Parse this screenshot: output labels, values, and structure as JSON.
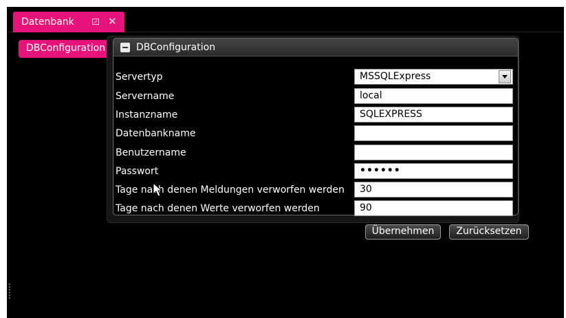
{
  "tab": {
    "title": "Datenbank",
    "close_glyph": "✕",
    "pin_icon": "pin-icon"
  },
  "subtab": {
    "label": "DBConfiguration"
  },
  "panel": {
    "title": "DBConfiguration",
    "collapse_icon": "collapse-minus-icon"
  },
  "form": {
    "rows": [
      {
        "label": "Servertyp",
        "value": "MSSQLExpress",
        "type": "dropdown"
      },
      {
        "label": "Servername",
        "value": "local",
        "type": "text"
      },
      {
        "label": "Instanzname",
        "value": "SQLEXPRESS",
        "type": "text"
      },
      {
        "label": "Datenbankname",
        "value": "",
        "type": "text"
      },
      {
        "label": "Benutzername",
        "value": "",
        "type": "text"
      },
      {
        "label": "Passwort",
        "value": "••••••",
        "type": "password"
      },
      {
        "label": "Tage nach denen Meldungen verworfen werden",
        "value": "30",
        "type": "text"
      },
      {
        "label": "Tage nach denen Werte verworfen werden",
        "value": "90",
        "type": "text"
      }
    ]
  },
  "buttons": {
    "apply": "Übernehmen",
    "reset": "Zurücksetzen"
  },
  "colors": {
    "accent": "#e6147a",
    "background": "#000000"
  }
}
